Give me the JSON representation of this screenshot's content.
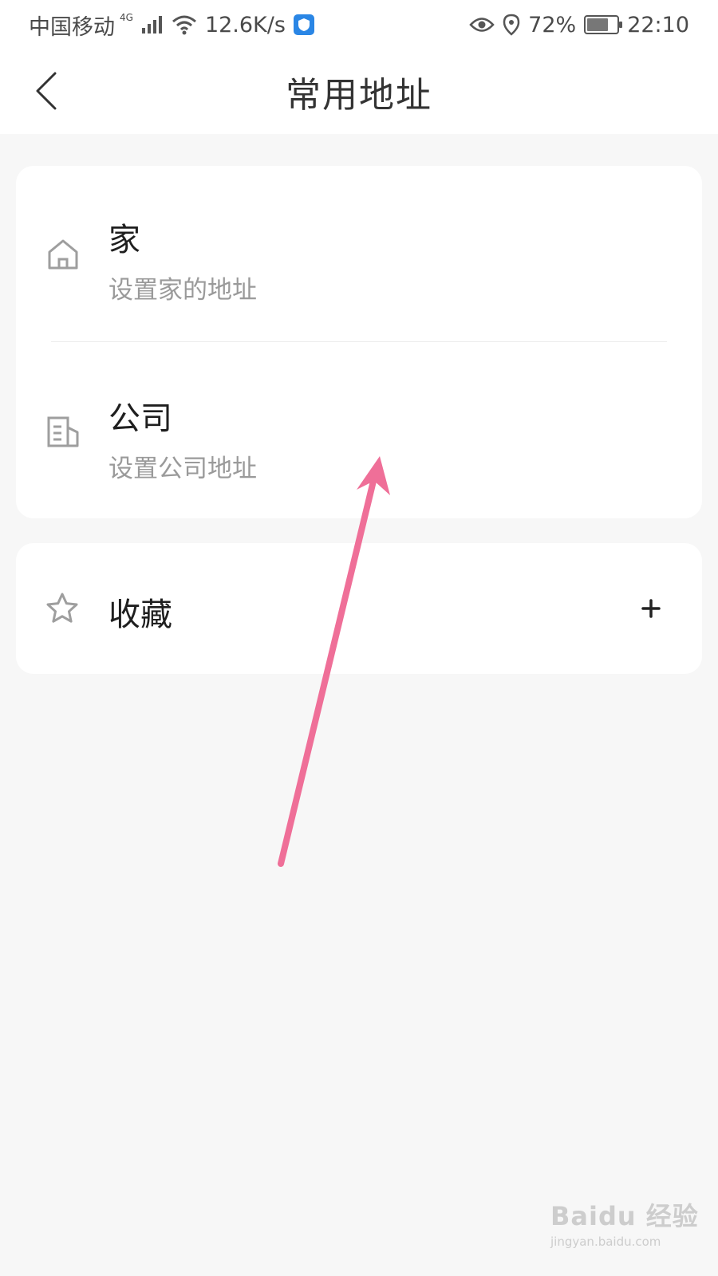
{
  "status_bar": {
    "carrier": "中国移动",
    "network": "4G",
    "speed": "12.6K/s",
    "battery": "72%",
    "time": "22:10"
  },
  "nav": {
    "title": "常用地址",
    "back_icon": "chevron-left-icon"
  },
  "addresses": {
    "home": {
      "title": "家",
      "subtitle": "设置家的地址",
      "icon": "home-icon"
    },
    "company": {
      "title": "公司",
      "subtitle": "设置公司地址",
      "icon": "building-icon"
    }
  },
  "favorites": {
    "title": "收藏",
    "icon": "star-icon",
    "add_icon": "plus-icon"
  },
  "colors": {
    "background": "#f7f7f7",
    "card": "#ffffff",
    "annotation_arrow": "#ef6f98",
    "subtitle": "#9a9a9a"
  },
  "watermark": {
    "logo": "Baidu 经验",
    "url": "jingyan.baidu.com"
  }
}
